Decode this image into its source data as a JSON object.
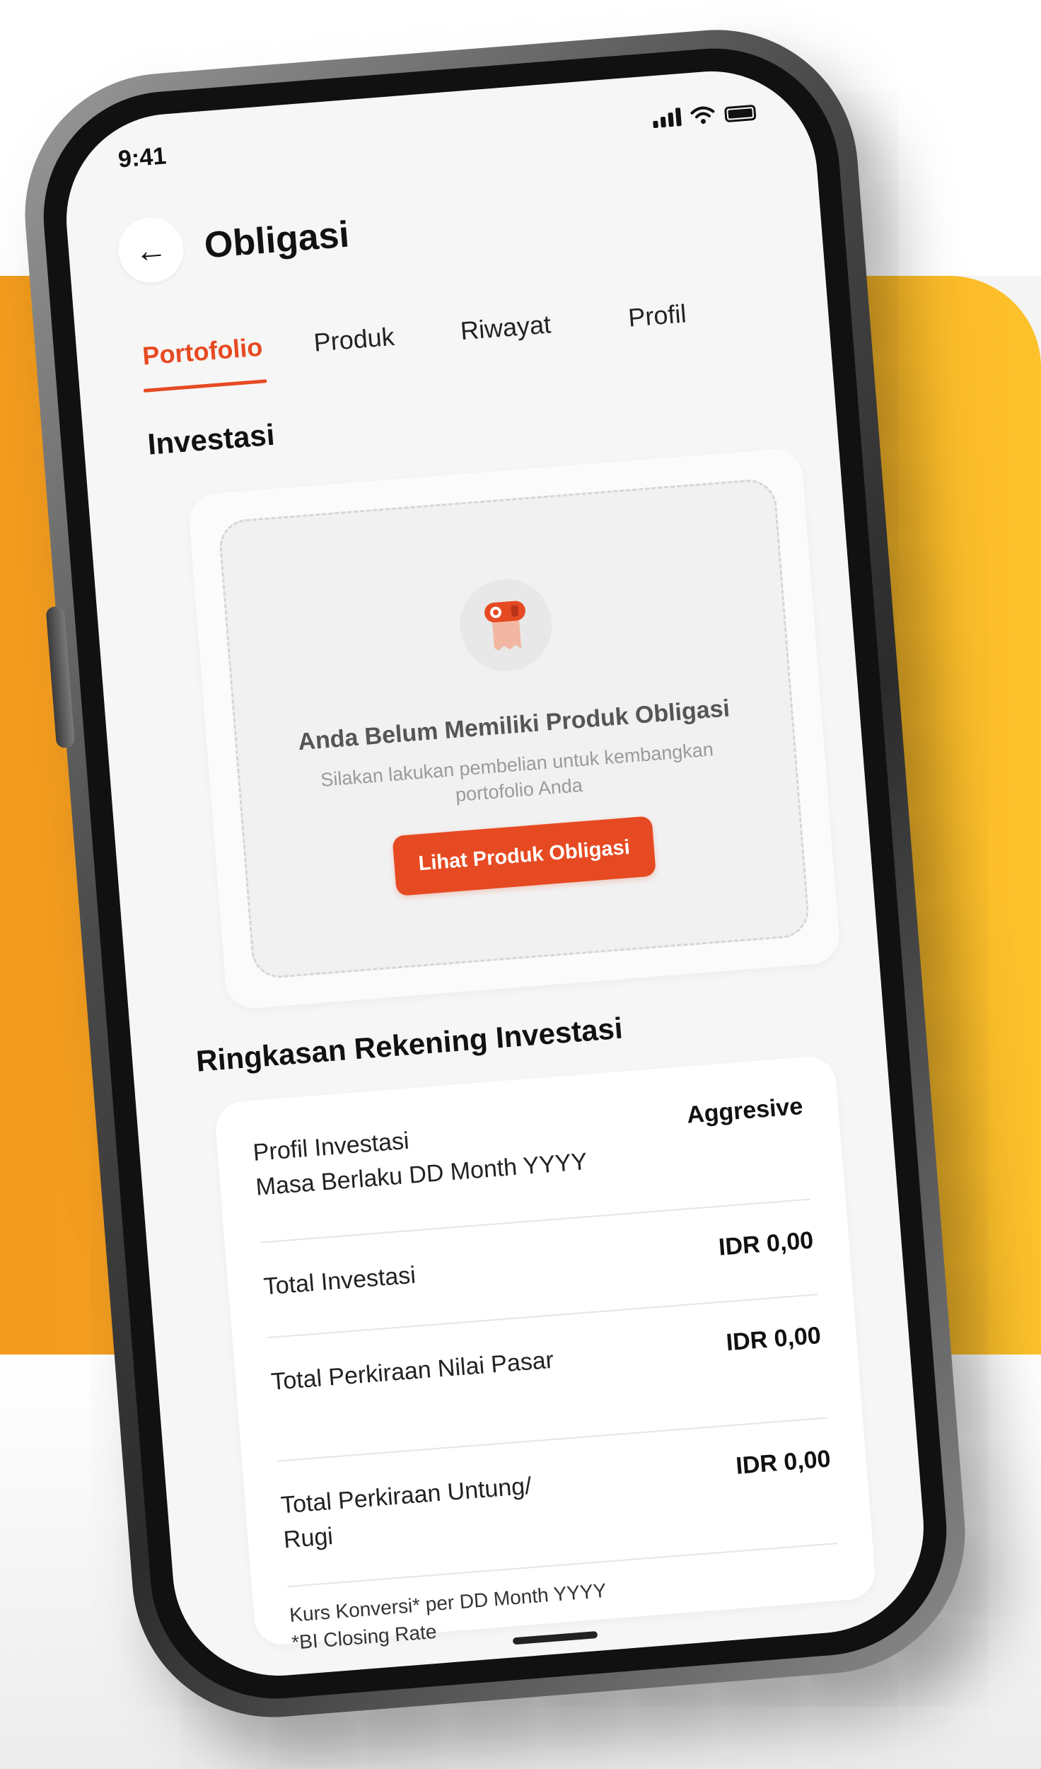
{
  "status_bar": {
    "time": "9:41"
  },
  "header": {
    "title": "Obligasi",
    "back_icon": "arrow-left-icon"
  },
  "tabs": [
    {
      "label": "Portofolio",
      "active": true
    },
    {
      "label": "Produk",
      "active": false
    },
    {
      "label": "Riwayat",
      "active": false
    },
    {
      "label": "Profil",
      "active": false
    }
  ],
  "investasi": {
    "section_title": "Investasi",
    "empty_state": {
      "icon": "bond-certificate-icon",
      "title": "Anda Belum Memiliki Produk Obligasi",
      "description": "Silakan lakukan pembelian untuk kembangkan portofolio Anda",
      "button_label": "Lihat Produk Obligasi"
    }
  },
  "summary": {
    "section_title": "Ringkasan Rekening Investasi",
    "rows": [
      {
        "label": "Profil Investasi",
        "sublabel": "Masa Berlaku DD Month YYYY",
        "value": "Aggresive"
      },
      {
        "label": "Total Investasi",
        "value": "IDR 0,00"
      },
      {
        "label": "Total Perkiraan Nilai Pasar",
        "value": "IDR 0,00"
      },
      {
        "label": "Total Perkiraan Untung/ Rugi",
        "value": "IDR 0,00"
      }
    ],
    "footnote_line1": "Kurs Konversi* per DD Month YYYY",
    "footnote_line2": "*BI Closing Rate"
  },
  "colors": {
    "accent": "#e64a22",
    "background_band_left": "#f39c1f",
    "background_band_right": "#fcc12b"
  }
}
